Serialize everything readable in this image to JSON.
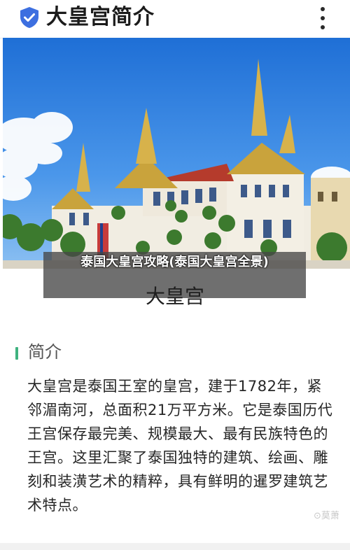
{
  "header": {
    "title": "大皇宫简介",
    "shield_color": "#3d6fe0",
    "menu_icon": "more-vertical-icon"
  },
  "hero": {
    "overlay_text": "泰国大皇宫攻略(泰国大皇宫全景)",
    "caption": "大皇宫"
  },
  "section": {
    "title": "简介",
    "accent_color": "#3fb27f",
    "paragraph": "大皇宫是泰国王室的皇宫，建于1782年，紧邻湄南河，总面积21万平方米。它是泰国历代王宫保存最完美、规模最大、最有民族特色的王宫。这里汇聚了泰国独特的建筑、绘画、雕刻和装潢艺术的精粹，具有鲜明的暹罗建筑艺术特点。"
  },
  "watermark": "⊙莫萧"
}
